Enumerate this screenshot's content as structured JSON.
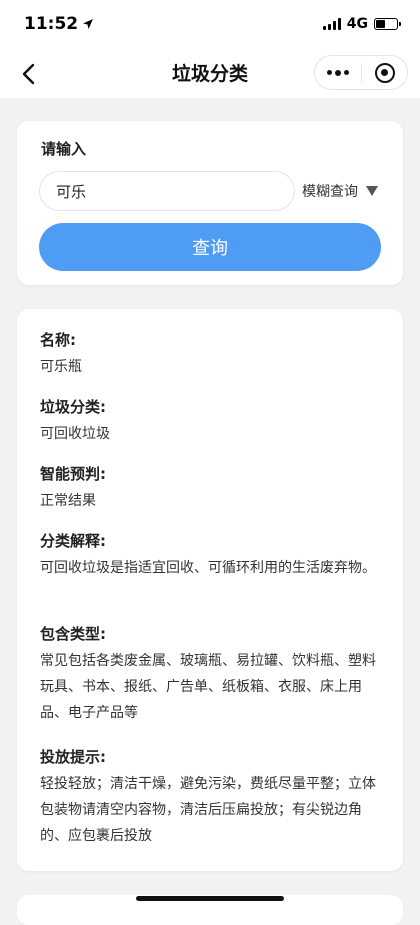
{
  "status": {
    "time": "11:52",
    "network": "4G"
  },
  "nav": {
    "title": "垃圾分类"
  },
  "search": {
    "label": "请输入",
    "value": "可乐",
    "mode": "模糊查询",
    "button": "查询"
  },
  "result": {
    "fields": [
      {
        "label": "名称:",
        "value": "可乐瓶"
      },
      {
        "label": "垃圾分类:",
        "value": "可回收垃圾"
      },
      {
        "label": "智能预判:",
        "value": "正常结果"
      },
      {
        "label": "分类解释:",
        "value": "可回收垃圾是指适宜回收、可循环利用的生活废弃物。"
      },
      {
        "label": "包含类型:",
        "value": "常见包括各类废金属、玻璃瓶、易拉罐、饮料瓶、塑料玩具、书本、报纸、广告单、纸板箱、衣服、床上用品、电子产品等"
      },
      {
        "label": "投放提示:",
        "value": "轻投轻放；清洁干燥，避免污染，费纸尽量平整；立体包装物请清空内容物，清洁后压扁投放；有尖锐边角的、应包裹后投放"
      }
    ]
  },
  "colors": {
    "accent": "#4f9cf5",
    "background": "#f2f2f2"
  }
}
